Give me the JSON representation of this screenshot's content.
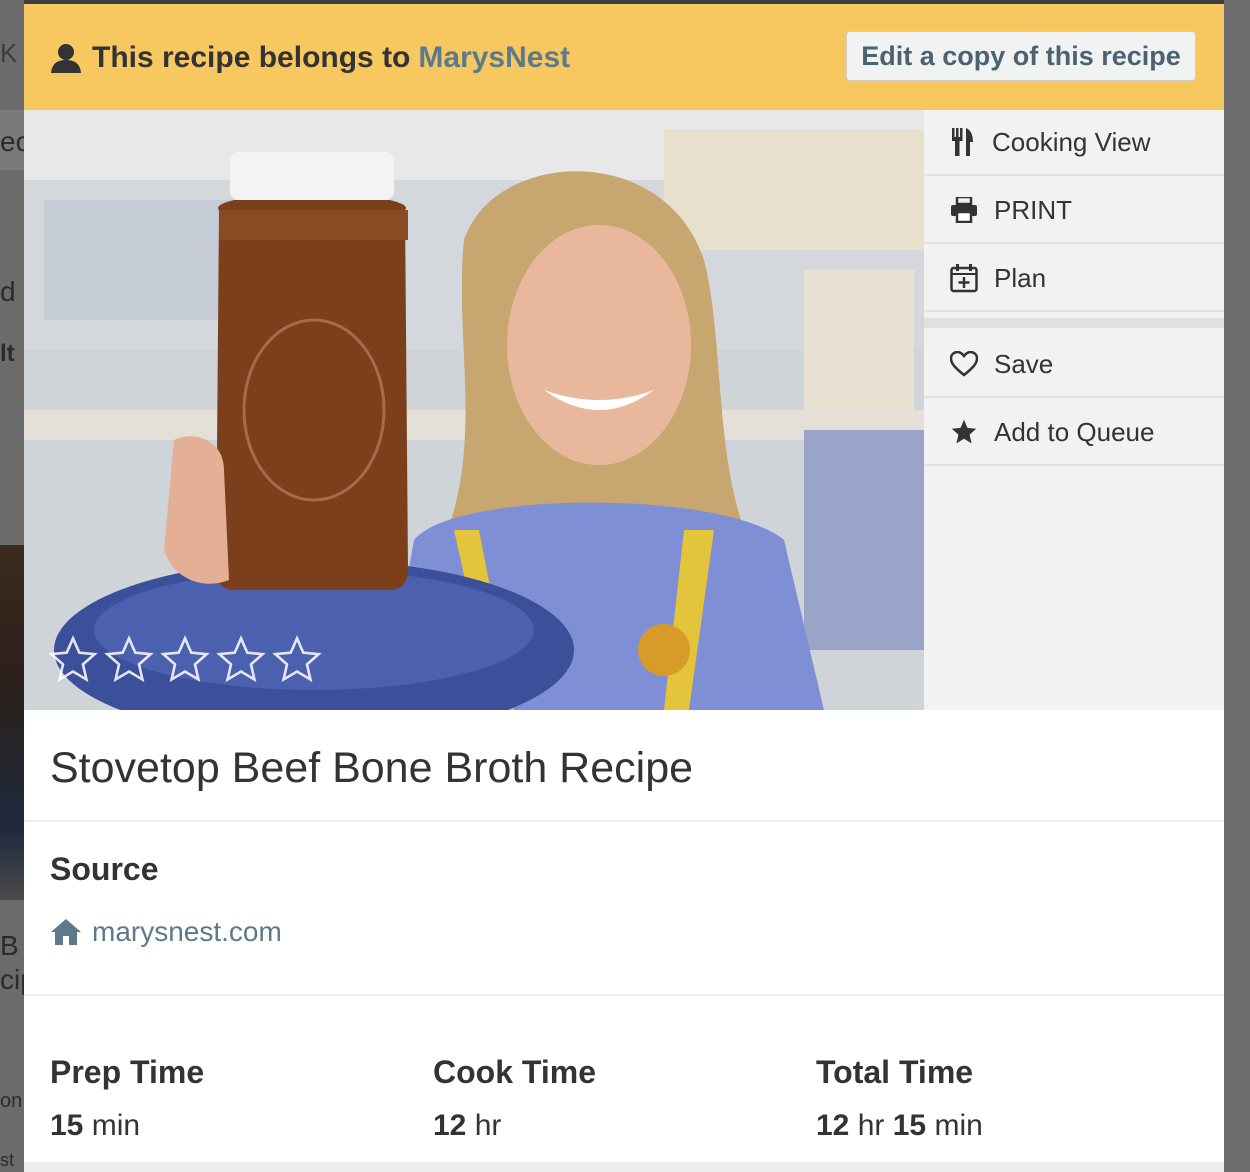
{
  "banner": {
    "prefix": "This recipe belongs to",
    "owner": "MarysNest",
    "edit_button": "Edit a copy of this recipe"
  },
  "photo": {
    "rating_stars_filled": 0,
    "rating_stars_total": 5
  },
  "actions": [
    {
      "label": "Cooking View",
      "icon": "utensils-icon"
    },
    {
      "label": "PRINT",
      "icon": "printer-icon"
    },
    {
      "label": "Plan",
      "icon": "calendar-plus-icon"
    },
    {
      "label": "Save",
      "icon": "heart-icon"
    },
    {
      "label": "Add to Queue",
      "icon": "star-icon"
    }
  ],
  "recipe": {
    "title": "Stovetop Beef Bone Broth Recipe",
    "source_heading": "Source",
    "source_link": "marysnest.com"
  },
  "times": {
    "prep": {
      "label": "Prep Time",
      "num1": "15",
      "unit1": "min"
    },
    "cook": {
      "label": "Cook Time",
      "num1": "12",
      "unit1": "hr"
    },
    "total": {
      "label": "Total Time",
      "num1": "12",
      "unit1": "hr",
      "num2": "15",
      "unit2": "min"
    }
  },
  "background_fragments": [
    "K",
    "ec",
    "d",
    "lt",
    "B",
    "cip",
    "on",
    "st"
  ],
  "colors": {
    "banner": "#f6c85f",
    "link": "#5d7a8c",
    "sidebar": "#f2f2f2"
  }
}
